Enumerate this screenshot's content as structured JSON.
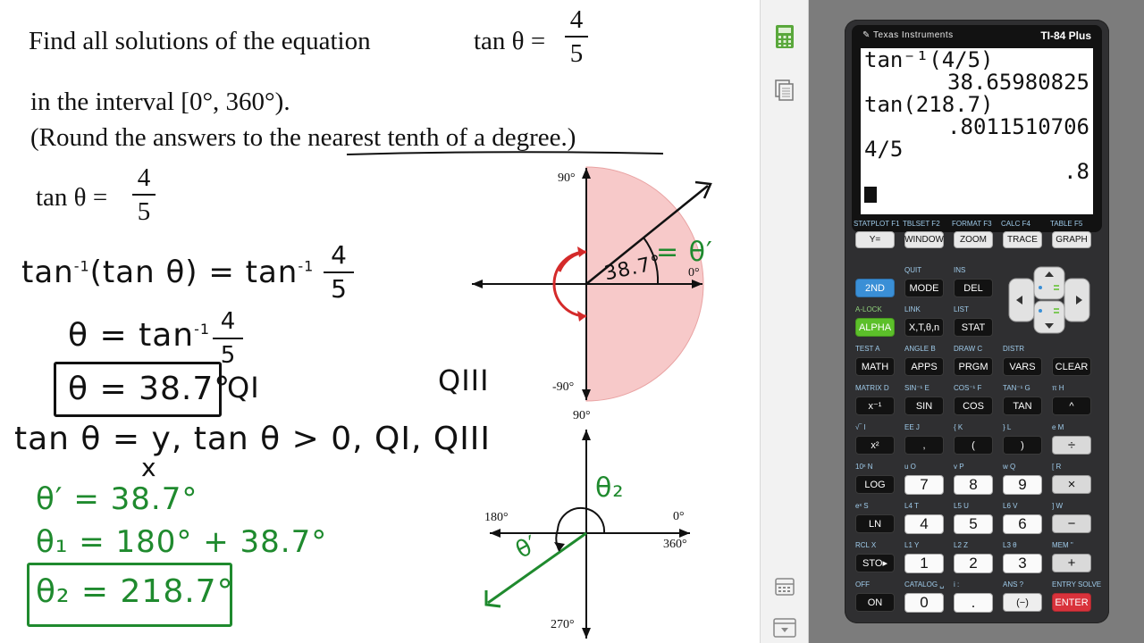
{
  "problem": {
    "line1": "Find all solutions of the equation",
    "tan_lhs": "tan θ =",
    "frac_num": "4",
    "frac_den": "5",
    "line2": "in the interval [0°, 360°).",
    "line3a": "(Round the answers to the ",
    "line3b": "nearest tenth of a degree.)"
  },
  "given": {
    "lhs": "tan θ =",
    "num": "4",
    "den": "5"
  },
  "work": {
    "step1a": "tan",
    "step1b": "(tan θ) = tan",
    "step1num": "4",
    "step1den": "5",
    "inv": "-1",
    "step2a": "θ = tan",
    "step2num": "4",
    "step2den": "5",
    "step3": "θ = 38.7°",
    "qi": "QI",
    "qiii": "QIII",
    "step4": "tan θ = y",
    "step4den": "x",
    "step4b": ", tan θ > 0, QI, QIII",
    "g1": "θ′ = 38.7°",
    "g2": "θ₁ = 180° + 38.7°",
    "g3": "θ₂ = 218.7°"
  },
  "graph1": {
    "label_90": "90°",
    "label_0": "0°",
    "label_m90": "-90°",
    "angle_text": "38.7°",
    "theta_prime": "= θ′"
  },
  "graph2": {
    "label_90": "90°",
    "label_0": "0°",
    "label_180": "180°",
    "label_360": "360°",
    "label_270": "270°",
    "theta2": "θ₂",
    "theta_prime": "θ′"
  },
  "strip": {
    "icons": [
      "calculator-icon",
      "documents-icon",
      "keypad-icon",
      "toolbar-icon"
    ]
  },
  "calculator": {
    "brand": "Texas Instruments",
    "model": "TI-84 Plus",
    "screen": {
      "l1": "tan⁻¹(4/5)",
      "l2": "38.65980825",
      "l3": "tan(218.7)",
      "l4": ".8011510706",
      "l5": "4/5",
      "l6": ".8"
    },
    "fn_labels": [
      "STATPLOT F1",
      "TBLSET F2",
      "FORMAT F3",
      "CALC F4",
      "TABLE F5"
    ],
    "fn_keys": [
      "Y=",
      "WINDOW",
      "ZOOM",
      "TRACE",
      "GRAPH"
    ],
    "row1_labels": [
      "QUIT",
      "INS"
    ],
    "row1_keys": [
      "2ND",
      "MODE",
      "DEL"
    ],
    "row2_labels": [
      "A-LOCK",
      "LINK",
      "LIST"
    ],
    "row2_keys": [
      "ALPHA",
      "X,T,θ,n",
      "STAT"
    ],
    "row3_labels": [
      "TEST  A",
      "ANGLE  B",
      "DRAW  C",
      "DISTR"
    ],
    "row3_keys": [
      "MATH",
      "APPS",
      "PRGM",
      "VARS",
      "CLEAR"
    ],
    "row4_labels": [
      "MATRIX  D",
      "SIN⁻¹  E",
      "COS⁻¹  F",
      "TAN⁻¹  G",
      "π  H"
    ],
    "row4_keys": [
      "x⁻¹",
      "SIN",
      "COS",
      "TAN",
      "^"
    ],
    "row5_labels": [
      "√‾  I",
      "EE  J",
      "{  K",
      "}  L",
      "e  M"
    ],
    "row5_keys": [
      "x²",
      ",",
      "(",
      ")",
      "÷"
    ],
    "row6_labels": [
      "10ˣ  N",
      "u  O",
      "v  P",
      "w  Q",
      "[  R"
    ],
    "row6_keys": [
      "LOG",
      "7",
      "8",
      "9",
      "×"
    ],
    "row7_labels": [
      "eˣ  S",
      "L4  T",
      "L5  U",
      "L6  V",
      "]  W"
    ],
    "row7_keys": [
      "LN",
      "4",
      "5",
      "6",
      "−"
    ],
    "row8_labels": [
      "RCL  X",
      "L1  Y",
      "L2  Z",
      "L3  θ",
      "MEM  \""
    ],
    "row8_keys": [
      "STO▸",
      "1",
      "2",
      "3",
      "+"
    ],
    "row9_labels": [
      "OFF",
      "CATALOG  ␣",
      "i  :",
      "ANS  ?",
      "ENTRY SOLVE"
    ],
    "row9_keys": [
      "ON",
      "0",
      ".",
      "(−)",
      "ENTER"
    ]
  }
}
